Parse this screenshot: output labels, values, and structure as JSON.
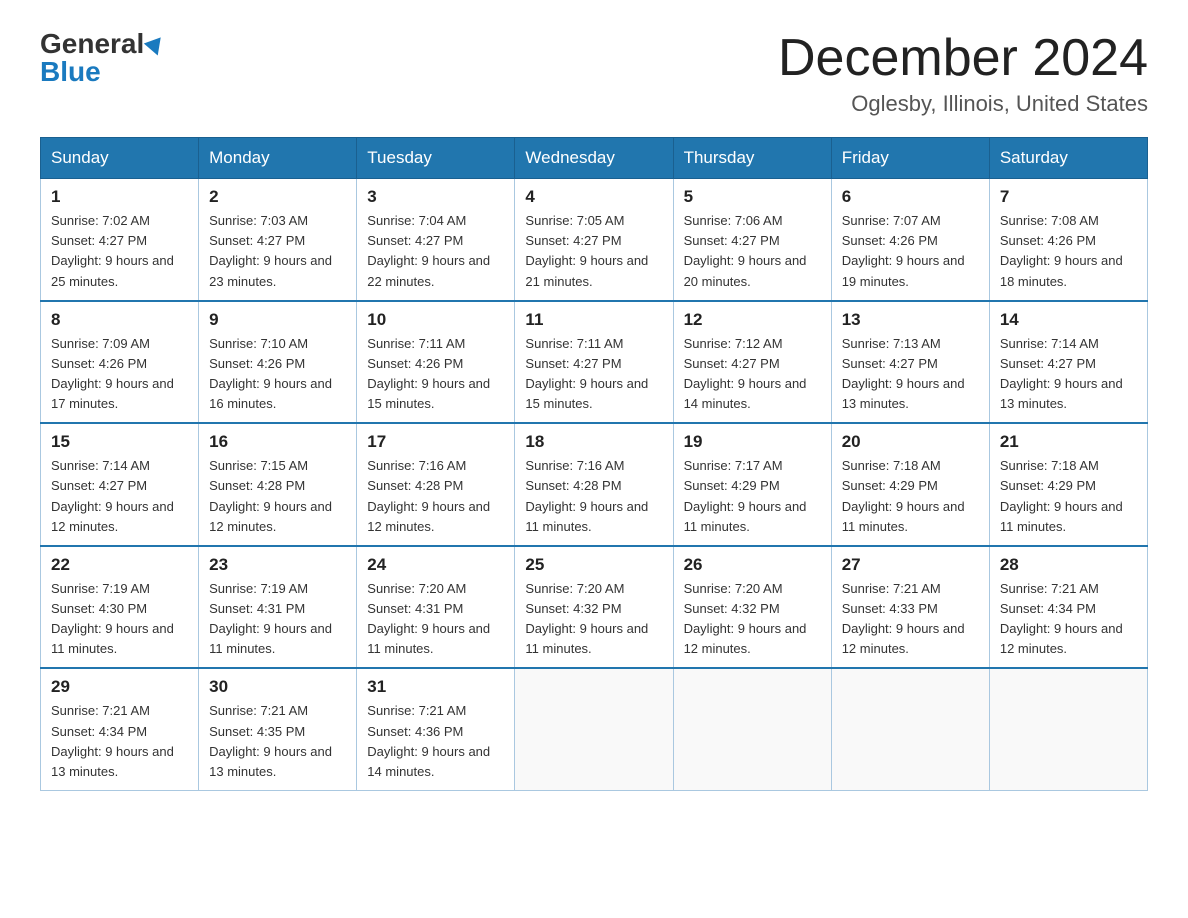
{
  "logo": {
    "general": "General",
    "blue": "Blue"
  },
  "header": {
    "month_year": "December 2024",
    "location": "Oglesby, Illinois, United States"
  },
  "weekdays": [
    "Sunday",
    "Monday",
    "Tuesday",
    "Wednesday",
    "Thursday",
    "Friday",
    "Saturday"
  ],
  "weeks": [
    [
      {
        "day": "1",
        "sunrise": "7:02 AM",
        "sunset": "4:27 PM",
        "daylight": "9 hours and 25 minutes."
      },
      {
        "day": "2",
        "sunrise": "7:03 AM",
        "sunset": "4:27 PM",
        "daylight": "9 hours and 23 minutes."
      },
      {
        "day": "3",
        "sunrise": "7:04 AM",
        "sunset": "4:27 PM",
        "daylight": "9 hours and 22 minutes."
      },
      {
        "day": "4",
        "sunrise": "7:05 AM",
        "sunset": "4:27 PM",
        "daylight": "9 hours and 21 minutes."
      },
      {
        "day": "5",
        "sunrise": "7:06 AM",
        "sunset": "4:27 PM",
        "daylight": "9 hours and 20 minutes."
      },
      {
        "day": "6",
        "sunrise": "7:07 AM",
        "sunset": "4:26 PM",
        "daylight": "9 hours and 19 minutes."
      },
      {
        "day": "7",
        "sunrise": "7:08 AM",
        "sunset": "4:26 PM",
        "daylight": "9 hours and 18 minutes."
      }
    ],
    [
      {
        "day": "8",
        "sunrise": "7:09 AM",
        "sunset": "4:26 PM",
        "daylight": "9 hours and 17 minutes."
      },
      {
        "day": "9",
        "sunrise": "7:10 AM",
        "sunset": "4:26 PM",
        "daylight": "9 hours and 16 minutes."
      },
      {
        "day": "10",
        "sunrise": "7:11 AM",
        "sunset": "4:26 PM",
        "daylight": "9 hours and 15 minutes."
      },
      {
        "day": "11",
        "sunrise": "7:11 AM",
        "sunset": "4:27 PM",
        "daylight": "9 hours and 15 minutes."
      },
      {
        "day": "12",
        "sunrise": "7:12 AM",
        "sunset": "4:27 PM",
        "daylight": "9 hours and 14 minutes."
      },
      {
        "day": "13",
        "sunrise": "7:13 AM",
        "sunset": "4:27 PM",
        "daylight": "9 hours and 13 minutes."
      },
      {
        "day": "14",
        "sunrise": "7:14 AM",
        "sunset": "4:27 PM",
        "daylight": "9 hours and 13 minutes."
      }
    ],
    [
      {
        "day": "15",
        "sunrise": "7:14 AM",
        "sunset": "4:27 PM",
        "daylight": "9 hours and 12 minutes."
      },
      {
        "day": "16",
        "sunrise": "7:15 AM",
        "sunset": "4:28 PM",
        "daylight": "9 hours and 12 minutes."
      },
      {
        "day": "17",
        "sunrise": "7:16 AM",
        "sunset": "4:28 PM",
        "daylight": "9 hours and 12 minutes."
      },
      {
        "day": "18",
        "sunrise": "7:16 AM",
        "sunset": "4:28 PM",
        "daylight": "9 hours and 11 minutes."
      },
      {
        "day": "19",
        "sunrise": "7:17 AM",
        "sunset": "4:29 PM",
        "daylight": "9 hours and 11 minutes."
      },
      {
        "day": "20",
        "sunrise": "7:18 AM",
        "sunset": "4:29 PM",
        "daylight": "9 hours and 11 minutes."
      },
      {
        "day": "21",
        "sunrise": "7:18 AM",
        "sunset": "4:29 PM",
        "daylight": "9 hours and 11 minutes."
      }
    ],
    [
      {
        "day": "22",
        "sunrise": "7:19 AM",
        "sunset": "4:30 PM",
        "daylight": "9 hours and 11 minutes."
      },
      {
        "day": "23",
        "sunrise": "7:19 AM",
        "sunset": "4:31 PM",
        "daylight": "9 hours and 11 minutes."
      },
      {
        "day": "24",
        "sunrise": "7:20 AM",
        "sunset": "4:31 PM",
        "daylight": "9 hours and 11 minutes."
      },
      {
        "day": "25",
        "sunrise": "7:20 AM",
        "sunset": "4:32 PM",
        "daylight": "9 hours and 11 minutes."
      },
      {
        "day": "26",
        "sunrise": "7:20 AM",
        "sunset": "4:32 PM",
        "daylight": "9 hours and 12 minutes."
      },
      {
        "day": "27",
        "sunrise": "7:21 AM",
        "sunset": "4:33 PM",
        "daylight": "9 hours and 12 minutes."
      },
      {
        "day": "28",
        "sunrise": "7:21 AM",
        "sunset": "4:34 PM",
        "daylight": "9 hours and 12 minutes."
      }
    ],
    [
      {
        "day": "29",
        "sunrise": "7:21 AM",
        "sunset": "4:34 PM",
        "daylight": "9 hours and 13 minutes."
      },
      {
        "day": "30",
        "sunrise": "7:21 AM",
        "sunset": "4:35 PM",
        "daylight": "9 hours and 13 minutes."
      },
      {
        "day": "31",
        "sunrise": "7:21 AM",
        "sunset": "4:36 PM",
        "daylight": "9 hours and 14 minutes."
      },
      null,
      null,
      null,
      null
    ]
  ]
}
